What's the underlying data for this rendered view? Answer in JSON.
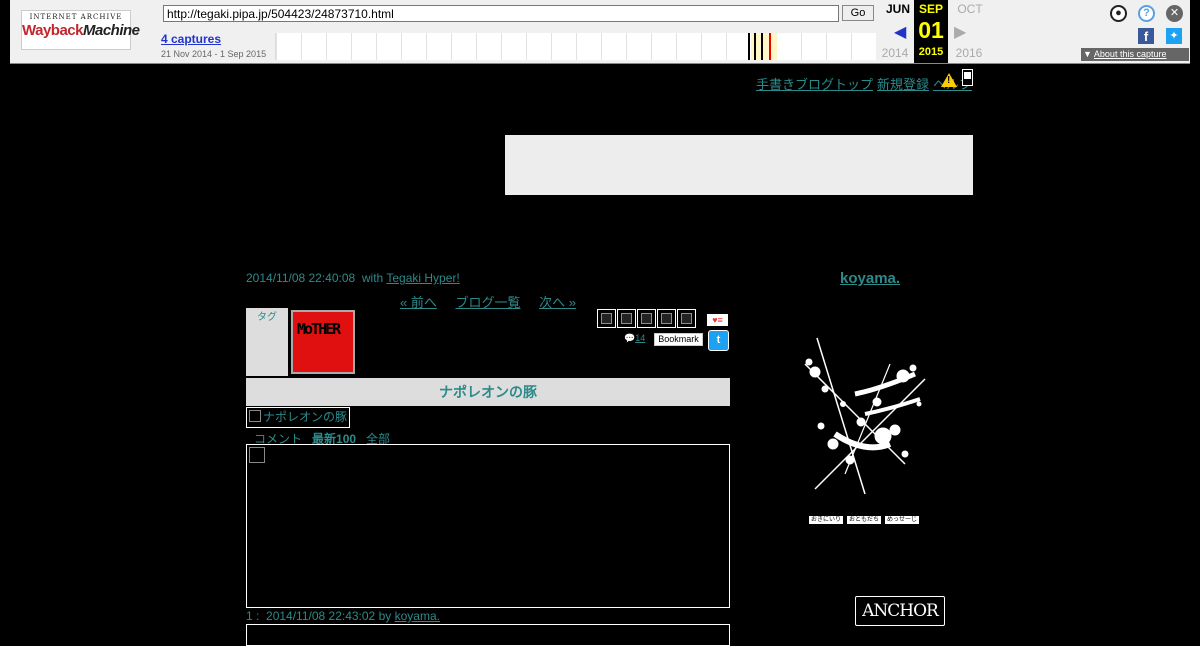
{
  "wayback": {
    "logo_line1": "INTERNET ARCHIVE",
    "logo_line2a": "Wayback",
    "logo_line2b": "Machine",
    "url": "http://tegaki.pipa.jp/504423/24873710.html",
    "go_label": "Go",
    "captures": "4 captures",
    "range": "21 Nov 2014 - 1 Sep 2015",
    "prev_month": "JUN",
    "cur_month": "SEP",
    "next_month": "OCT",
    "cur_day": "01",
    "prev_year": "2014",
    "cur_year": "2015",
    "next_year": "2016",
    "about": "About this capture",
    "accent": "#ffff00"
  },
  "topnav": {
    "items": [
      "手書きブログトップ",
      "新規登録",
      "ヘルプ"
    ]
  },
  "post": {
    "date": "2014/11/08 22:40:08",
    "with_prefix": "with",
    "with_link": "Tegaki Hyper!",
    "prev": "« 前へ",
    "list": "ブログ一覧",
    "next": "次へ »",
    "tag_label": "タグ",
    "thumb_text": "MoTHER",
    "like_label": "♥≡",
    "comment_count": "14",
    "bookmark": "Bookmark",
    "title": "ナポレオンの豚",
    "image_alt": "ナポレオンの豚",
    "comment_label": "コメント",
    "latest": "最新100",
    "all": "全部",
    "comment1_no": "1 :",
    "comment1_date": "2014/11/08 22:43:02",
    "comment1_by": "by",
    "comment1_author": "koyama."
  },
  "profile": {
    "name": "koyama.",
    "tabs": [
      "おきにいり",
      "おともだち",
      "めっせーじ"
    ],
    "anchor": "ANCHOR"
  }
}
